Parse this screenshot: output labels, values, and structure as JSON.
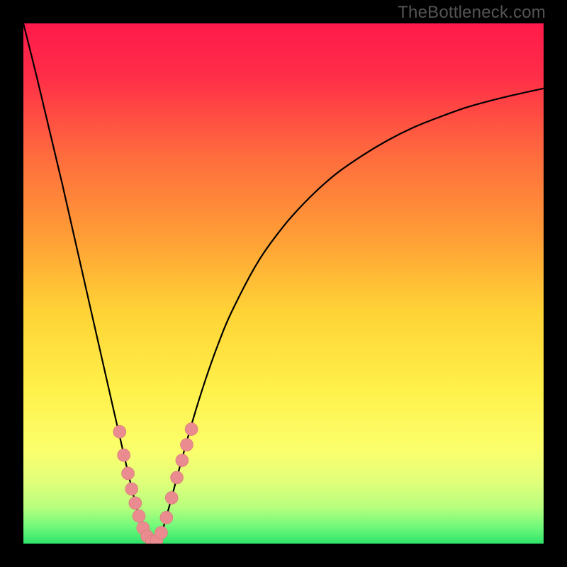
{
  "watermark": "TheBottleneck.com",
  "colors": {
    "gradient_stops": [
      {
        "offset": 0.0,
        "color": "#ff1a4b"
      },
      {
        "offset": 0.1,
        "color": "#ff2d48"
      },
      {
        "offset": 0.25,
        "color": "#ff6a3e"
      },
      {
        "offset": 0.4,
        "color": "#ff9a36"
      },
      {
        "offset": 0.55,
        "color": "#ffd236"
      },
      {
        "offset": 0.7,
        "color": "#fff049"
      },
      {
        "offset": 0.82,
        "color": "#fbff6c"
      },
      {
        "offset": 0.88,
        "color": "#e2ff7a"
      },
      {
        "offset": 0.93,
        "color": "#b8ff7d"
      },
      {
        "offset": 0.97,
        "color": "#6cf87a"
      },
      {
        "offset": 1.0,
        "color": "#2fe36a"
      }
    ],
    "curve": "#000000",
    "marker_fill": "#e98b8f",
    "marker_stroke": "#d87679"
  },
  "chart_data": {
    "type": "line",
    "title": "",
    "xlabel": "",
    "ylabel": "",
    "xlim": [
      0,
      100
    ],
    "ylim": [
      0,
      100
    ],
    "series": [
      {
        "name": "bottleneck-curve",
        "x": [
          0.0,
          2.5,
          5.0,
          7.5,
          10.0,
          12.5,
          15.0,
          17.5,
          19.0,
          20.5,
          22.0,
          23.5,
          25.0,
          26.5,
          28.0,
          30.0,
          32.5,
          35.0,
          37.5,
          40.0,
          45.0,
          50.0,
          55.0,
          60.0,
          65.0,
          70.0,
          75.0,
          80.0,
          85.0,
          90.0,
          95.0,
          100.0
        ],
        "y": [
          100.0,
          90.0,
          79.5,
          69.0,
          58.0,
          47.0,
          36.0,
          25.0,
          18.5,
          12.0,
          6.0,
          1.5,
          0.0,
          2.0,
          7.0,
          14.5,
          23.5,
          31.5,
          38.5,
          44.5,
          54.0,
          61.0,
          66.5,
          71.0,
          74.5,
          77.5,
          80.0,
          82.0,
          83.8,
          85.2,
          86.4,
          87.5
        ]
      }
    ],
    "markers": [
      {
        "x": 18.5,
        "y": 21.5
      },
      {
        "x": 19.3,
        "y": 17.0
      },
      {
        "x": 20.1,
        "y": 13.5
      },
      {
        "x": 20.8,
        "y": 10.5
      },
      {
        "x": 21.5,
        "y": 7.8
      },
      {
        "x": 22.2,
        "y": 5.3
      },
      {
        "x": 23.0,
        "y": 3.0
      },
      {
        "x": 23.8,
        "y": 1.4
      },
      {
        "x": 24.7,
        "y": 0.4
      },
      {
        "x": 25.6,
        "y": 0.6
      },
      {
        "x": 26.5,
        "y": 2.1
      },
      {
        "x": 27.5,
        "y": 5.0
      },
      {
        "x": 28.5,
        "y": 8.8
      },
      {
        "x": 29.5,
        "y": 12.7
      },
      {
        "x": 30.5,
        "y": 16.0
      },
      {
        "x": 31.4,
        "y": 19.0
      },
      {
        "x": 32.3,
        "y": 22.0
      }
    ],
    "marker_radius": 9
  }
}
